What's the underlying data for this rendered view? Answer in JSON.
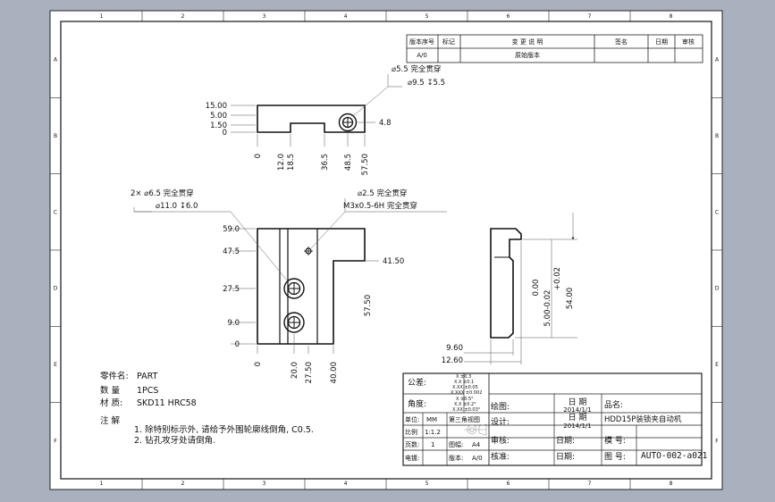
{
  "border": {
    "top_numbers": [
      "1",
      "2",
      "3",
      "4",
      "5",
      "6",
      "7",
      "8"
    ],
    "side_letters": [
      "A",
      "B",
      "C",
      "D",
      "E",
      "F"
    ]
  },
  "revision_table": {
    "headers": [
      "版本序号",
      "标记",
      "变 更 说 明",
      "签名",
      "日期",
      "审核"
    ],
    "row": {
      "version": "A/0",
      "desc": "原始版本"
    }
  },
  "top_view": {
    "hole_note_1": "⌀5.5 完全贯穿",
    "hole_note_2": "⌀9.5 ↧5.5",
    "left_dims": [
      "15.00",
      "5.00",
      "1.50",
      "0"
    ],
    "right_dim": "4.8",
    "bottom_dims": [
      "0",
      "12.0",
      "18.5",
      "36.5",
      "48.5",
      "57.50"
    ]
  },
  "front_view": {
    "note_a1": "2× ⌀6.5 完全贯穿",
    "note_a2": "⌀11.0 ↧6.0",
    "note_b1": "⌀2.5 完全贯穿",
    "note_b2": "M3x0.5-6H 完全贯穿",
    "left_dims": [
      "59.0",
      "47.5",
      "27.5",
      "9.0",
      "0"
    ],
    "right_dims": [
      "41.50",
      "57.50"
    ],
    "bottom_dims": [
      "0",
      "20.0",
      "27.50",
      "40.00"
    ]
  },
  "side_view": {
    "vertical_dims": [
      "0.00",
      "5.00-0.02",
      "+0.02",
      "54.00"
    ],
    "bottom_dims": [
      "9.60",
      "12.60"
    ]
  },
  "notes": {
    "part_name_label": "零件名:",
    "part_name": "PART",
    "qty_label": "数 量",
    "qty": "1PCS",
    "material_label": "材 质:",
    "material": "SKD11 HRC58",
    "notes_label": "注 解",
    "note1": "1. 除特别标示外, 请给予外围轮廓线倒角, C0.5.",
    "note2": "2. 钻孔攻牙处请倒角."
  },
  "title_block": {
    "tolerance_label": "公差:",
    "tolerance_values": [
      "X ±0.3",
      "X.X ±0.1",
      "X.XX ±0.05",
      "X.XXX ±0.002"
    ],
    "angle_label": "角度:",
    "angle_values": [
      "X ±0.5°",
      "X.X ±0.2°",
      "X.XX ±0.03°"
    ],
    "unit_label": "单位:",
    "unit": "MM",
    "projection": "第三角视图",
    "scale_label": "比例",
    "scale": "1:1.2",
    "pages_label": "页数:",
    "pages": "1",
    "sheet_label": "图幅:",
    "sheet": "A4",
    "process_label": "电镀:",
    "version_label": "版本:",
    "version": "A/0",
    "drawn_label": "绘图:",
    "design_label": "设计:",
    "check_label": "审核:",
    "approve_label": "核准:",
    "date_header": "日 期",
    "drawn_date": "2014/1/1",
    "design_date": "2014/1/1",
    "date_label": "日期:",
    "product_label": "品名:",
    "product": "HDD15P装锁夹自动机",
    "model_label": "模 号:",
    "drawing_no_label": "图 号:",
    "drawing_no": "AUTO-002-a021"
  }
}
